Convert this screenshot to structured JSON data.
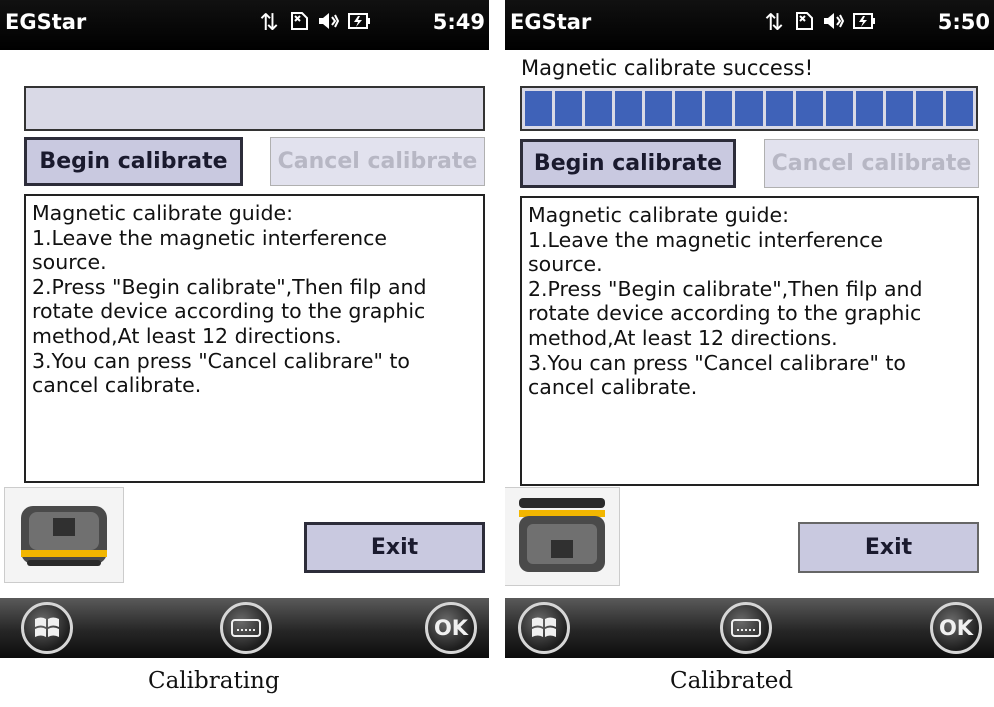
{
  "colors": {
    "titlebar": "#000000",
    "progress_fill": "#3f62b8",
    "button_bg": "#c9c9e0",
    "disabled_text": "#b7b7c4"
  },
  "left": {
    "app_title": "EGStar",
    "clock": "5:49",
    "status_icons": [
      "sync-icon",
      "no-sim-icon",
      "volume-icon",
      "battery-icon"
    ],
    "progress_fraction": 0,
    "begin_button": "Begin calibrate",
    "cancel_button": "Cancel calibrate",
    "guide": [
      "Magnetic calibrate guide:",
      "1.Leave the magnetic interference",
      "source.",
      "2.Press \"Begin calibrate\",Then filp and",
      "rotate device according to the graphic",
      "method,At least 12 directions.",
      "3.You can press \"Cancel calibrare\" to",
      "cancel calibrate."
    ],
    "exit_button": "Exit",
    "ok_button": "OK",
    "caption": "Calibrating"
  },
  "right": {
    "app_title": "EGStar",
    "clock": "5:50",
    "status_icons": [
      "sync-icon",
      "no-sim-icon",
      "volume-icon",
      "battery-icon"
    ],
    "status_message": "Magnetic calibrate success!",
    "progress_fraction": 1,
    "progress_segments": 15,
    "begin_button": "Begin calibrate",
    "cancel_button": "Cancel calibrate",
    "guide": [
      "Magnetic calibrate guide:",
      "1.Leave the magnetic interference",
      "source.",
      "2.Press \"Begin calibrate\",Then filp and",
      "rotate device according to the graphic",
      "method,At least 12 directions.",
      "3.You can press \"Cancel calibrare\" to",
      "cancel calibrate."
    ],
    "exit_button": "Exit",
    "ok_button": "OK",
    "caption": "Calibrated"
  }
}
